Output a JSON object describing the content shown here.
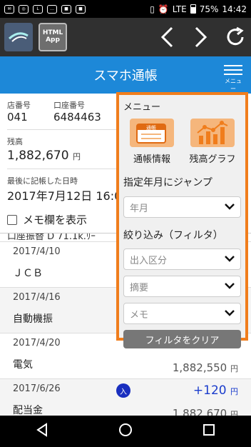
{
  "status": {
    "signal": "LTE",
    "battery": "75%",
    "time": "14:42"
  },
  "header": {
    "title": "スマホ通帳",
    "menu_label": "メニュー"
  },
  "account": {
    "branch_label": "店番号",
    "branch_value": "041",
    "account_label": "口座番号",
    "account_value": "6484463",
    "balance_label": "残高",
    "balance_value": "1,882,670",
    "currency": "円",
    "last_date_label": "最後に記帳した日時",
    "last_date_value": "2017年7月12日 16:0",
    "memo_label": "メモ欄を表示"
  },
  "cut_row_text": "口座振替 D 71.1k.ﾘｰ",
  "transactions": [
    {
      "date": "2017/4/10",
      "description": "ＪＣＢ",
      "amount": "",
      "balance": ""
    },
    {
      "date": "2017/4/16",
      "description": "自動機振",
      "amount": "",
      "balance": ""
    },
    {
      "date": "2017/4/20",
      "description": "電気",
      "amount": "",
      "balance": "1,882,550"
    },
    {
      "date": "2017/6/26",
      "description": "配当金",
      "badge": "入",
      "amount": "+120",
      "balance": "1,882,670"
    }
  ],
  "menu": {
    "title": "メニュー",
    "passbook_caption": "通帳情報",
    "passbook_icon_text": "通帳",
    "graph_caption": "残高グラフ",
    "jump_title": "指定年月にジャンプ",
    "year_month_placeholder": "年月",
    "filter_title": "絞り込み（フィルタ）",
    "filter_type_placeholder": "出入区分",
    "filter_summary_placeholder": "摘要",
    "filter_memo_placeholder": "メモ",
    "clear_button": "フィルタをクリア"
  },
  "colors": {
    "accent": "#1d88d8",
    "menu_border": "#f07d1c",
    "deposit": "#1a3ccc"
  }
}
